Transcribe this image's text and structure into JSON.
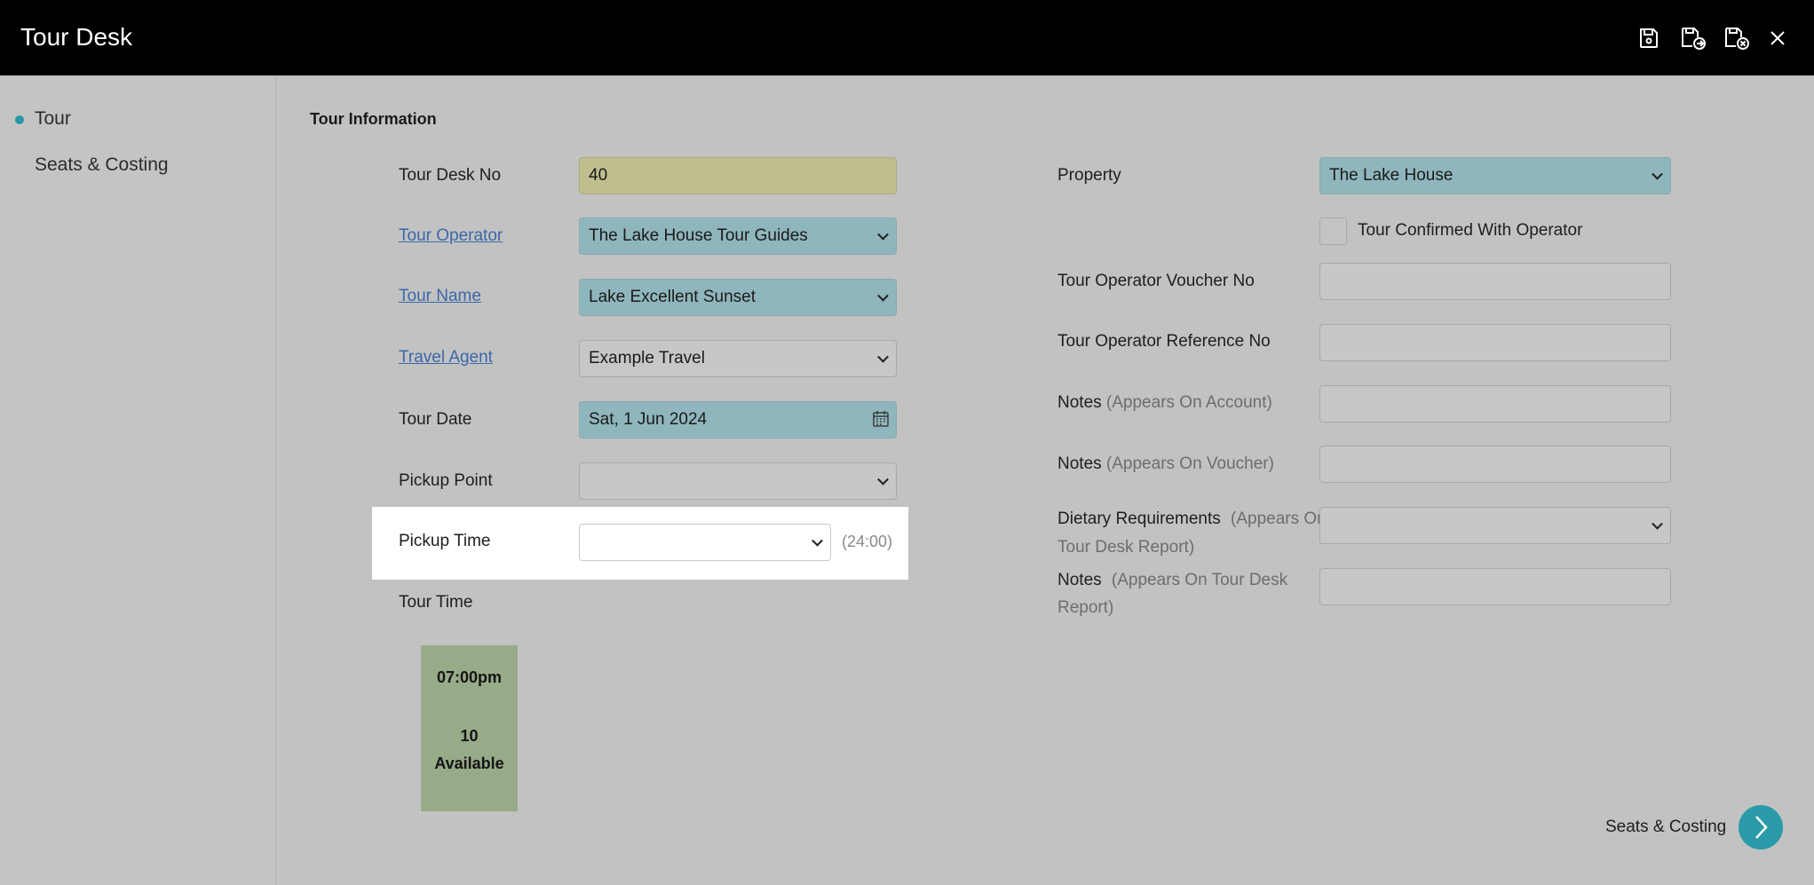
{
  "window": {
    "title": "Tour Desk",
    "icons": [
      "save-icon",
      "save-and-new-icon",
      "save-and-close-icon",
      "close-icon"
    ]
  },
  "sidebar": {
    "items": [
      {
        "label": "Tour",
        "active": true
      },
      {
        "label": "Seats & Costing",
        "active": false
      }
    ]
  },
  "section": {
    "title": "Tour Information"
  },
  "left_form": {
    "tour_desk_no": {
      "label": "Tour Desk No",
      "value": "40"
    },
    "tour_operator": {
      "label": "Tour Operator",
      "value": "The Lake House Tour Guides"
    },
    "tour_name": {
      "label": "Tour Name",
      "value": "Lake Excellent Sunset"
    },
    "travel_agent": {
      "label": "Travel Agent",
      "value": "Example Travel"
    },
    "tour_date": {
      "label": "Tour Date",
      "value": "Sat, 1 Jun 2024"
    },
    "pickup_point": {
      "label": "Pickup Point",
      "value": ""
    },
    "pickup_time": {
      "label": "Pickup Time",
      "value": "",
      "hint": "(24:00)"
    },
    "tour_time": {
      "label": "Tour Time"
    }
  },
  "tour_slot": {
    "time": "07:00pm",
    "count": "10",
    "status": "Available"
  },
  "right_form": {
    "property": {
      "label": "Property",
      "value": "The Lake House"
    },
    "confirmed": {
      "label": "Tour Confirmed With Operator",
      "checked": false
    },
    "voucher_no": {
      "label": "Tour Operator Voucher No",
      "value": ""
    },
    "reference_no": {
      "label": "Tour Operator Reference No",
      "value": ""
    },
    "notes_account": {
      "label": "Notes",
      "sub": "(Appears On Account)",
      "value": ""
    },
    "notes_voucher": {
      "label": "Notes",
      "sub": "(Appears On Voucher)",
      "value": ""
    },
    "dietary": {
      "label": "Dietary Requirements",
      "sub1": "(Appears On",
      "sub2": "Tour Desk Report)",
      "value": ""
    },
    "notes_report": {
      "label": "Notes",
      "sub1": "(Appears On Tour Desk",
      "sub2": "Report)",
      "value": ""
    }
  },
  "footer": {
    "next_label": "Seats & Costing"
  },
  "colors": {
    "accent": "#2a9aa8",
    "required_field": "#8fb6bc",
    "readonly_field": "#bfbe8e",
    "slot_available": "#97ab88"
  }
}
